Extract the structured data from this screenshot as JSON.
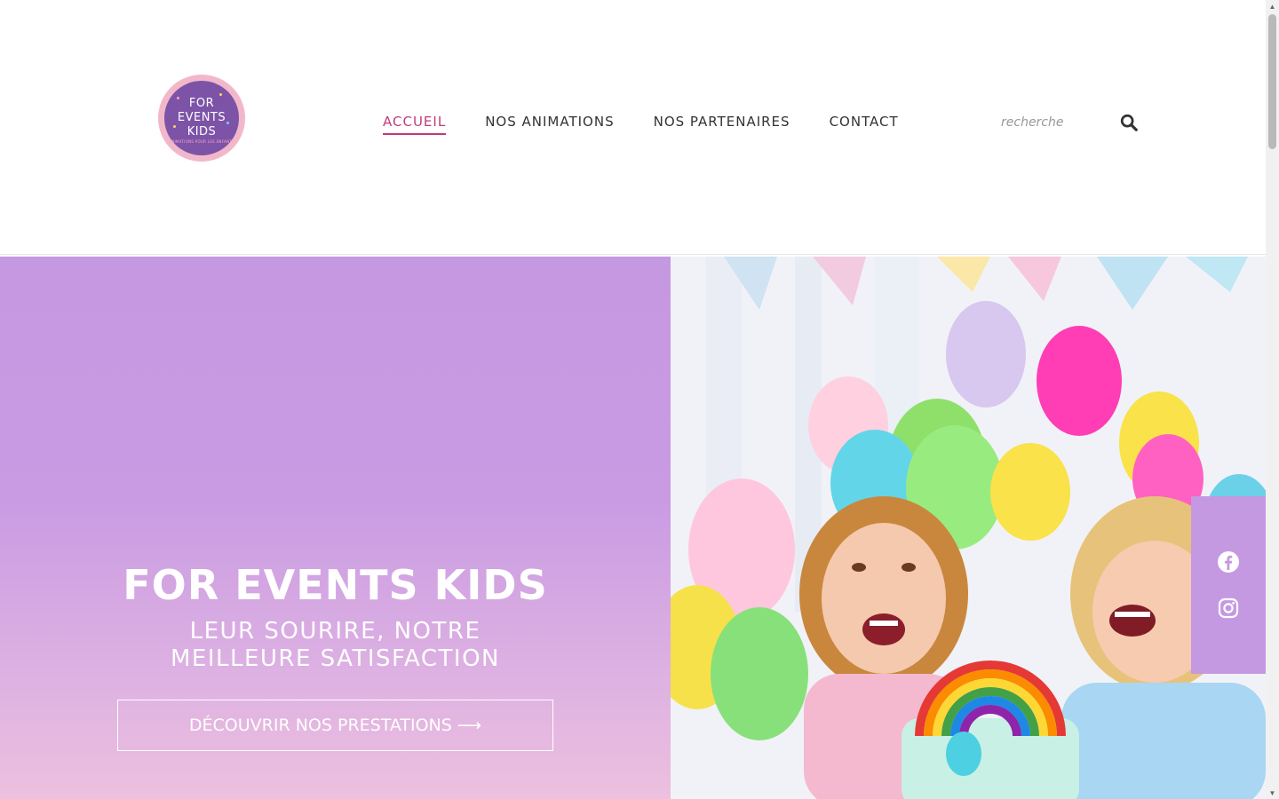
{
  "header": {
    "logo": {
      "lines": [
        "FOR",
        "EVENTS",
        "KIDS"
      ],
      "tagline": "ANIMATIONS POUR LES ENFANTS",
      "colors": {
        "ring": "#f2b8c9",
        "fill": "#7d53a8"
      }
    },
    "nav": [
      {
        "label": "ACCUEIL",
        "active": true
      },
      {
        "label": "NOS ANIMATIONS",
        "active": false
      },
      {
        "label": "NOS PARTENAIRES",
        "active": false
      },
      {
        "label": "CONTACT",
        "active": false
      }
    ],
    "search": {
      "placeholder": "recherche",
      "icon": "search-icon"
    }
  },
  "hero": {
    "title": "FOR EVENTS KIDS",
    "subtitle": "LEUR SOURIRE, NOTRE MEILLEURE SATISFACTION",
    "cta_label": "DÉCOUVRIR NOS PRESTATIONS ⟶",
    "image": "children-birthday-party-balloons-rainbow-cake",
    "colors": {
      "panel": "#c598e2",
      "accent": "#c13b7a",
      "text": "#ffffff"
    }
  },
  "social": {
    "items": [
      {
        "name": "facebook-icon"
      },
      {
        "name": "instagram-icon"
      }
    ],
    "color": "#c598e2"
  },
  "scrollbar": {
    "icon_up": "▲",
    "icon_down": "▼"
  }
}
